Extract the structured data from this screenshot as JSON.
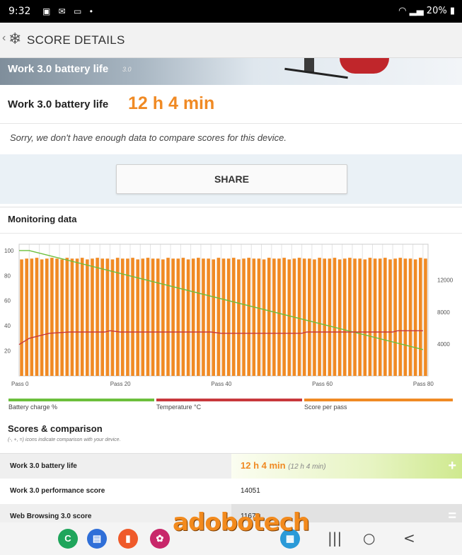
{
  "status_bar": {
    "time": "9:32",
    "battery": "20%"
  },
  "app_bar": {
    "title": "SCORE DETAILS"
  },
  "hero": {
    "title": "Work 3.0 battery life",
    "version": "3.0"
  },
  "result": {
    "label": "Work 3.0 battery life",
    "value": "12 h 4 min"
  },
  "compare_note": "Sorry, we don't have enough data to compare scores for this device.",
  "share_label": "SHARE",
  "monitoring": {
    "title": "Monitoring data",
    "legend": [
      {
        "label": "Battery charge %",
        "color": "#6cbf3c"
      },
      {
        "label": "Temperature °C",
        "color": "#c8383c"
      },
      {
        "label": "Score per pass",
        "color": "#f08a24"
      }
    ]
  },
  "chart_data": {
    "type": "bar",
    "x": {
      "tick_labels": [
        "Pass 0",
        "Pass 20",
        "Pass 40",
        "Pass 60",
        "Pass 80"
      ],
      "range": [
        0,
        81
      ]
    },
    "y_left": {
      "ticks": [
        20,
        40,
        60,
        80,
        100
      ],
      "range": [
        0,
        105
      ]
    },
    "y_right": {
      "ticks": [
        4000,
        8000,
        12000
      ],
      "range": [
        0,
        16500
      ]
    },
    "series": [
      {
        "name": "Score per pass",
        "type": "bar",
        "axis": "right",
        "color": "#f08a24",
        "values": [
          14600,
          14700,
          14700,
          14800,
          14600,
          14700,
          14800,
          14700,
          14600,
          14800,
          14700,
          14700,
          14800,
          14600,
          14700,
          14800,
          14700,
          14700,
          14600,
          14800,
          14700,
          14700,
          14800,
          14600,
          14700,
          14800,
          14700,
          14700,
          14600,
          14800,
          14700,
          14700,
          14800,
          14600,
          14700,
          14800,
          14700,
          14700,
          14600,
          14800,
          14700,
          14700,
          14800,
          14600,
          14700,
          14800,
          14700,
          14700,
          14600,
          14800,
          14700,
          14700,
          14800,
          14600,
          14700,
          14800,
          14700,
          14700,
          14600,
          14800,
          14700,
          14700,
          14800,
          14600,
          14700,
          14800,
          14700,
          14700,
          14600,
          14800,
          14700,
          14700,
          14800,
          14600,
          14700,
          14800,
          14700,
          14700,
          14600,
          14800,
          14700
        ]
      },
      {
        "name": "Battery charge %",
        "type": "line",
        "axis": "left",
        "color": "#6cbf3c",
        "points": [
          [
            0,
            100
          ],
          [
            2,
            100
          ],
          [
            80,
            21
          ]
        ]
      },
      {
        "name": "Temperature °C",
        "type": "line",
        "axis": "left",
        "color": "#c8383c",
        "points": [
          [
            0,
            25
          ],
          [
            2,
            30
          ],
          [
            4,
            32
          ],
          [
            6,
            34
          ],
          [
            10,
            35
          ],
          [
            17,
            35
          ],
          [
            18,
            36
          ],
          [
            20,
            35
          ],
          [
            38,
            35
          ],
          [
            40,
            34
          ],
          [
            56,
            34
          ],
          [
            57,
            35
          ],
          [
            74,
            35
          ],
          [
            75,
            36
          ],
          [
            80,
            36
          ]
        ]
      }
    ],
    "grid": true
  },
  "scores": {
    "title": "Scores & comparison",
    "note": "(-, +, =) icons indicate comparison with your device.",
    "rows": [
      {
        "name": "Work 3.0 battery life",
        "value": "12 h 4 min",
        "sub": "(12 h 4 min)",
        "icon": "+"
      },
      {
        "name": "Work 3.0 performance score",
        "value": "14051"
      },
      {
        "name": "Web Browsing 3.0 score",
        "value": "11675",
        "icon": "="
      }
    ]
  },
  "watermark": "adobotech",
  "nav": {
    "recents": "|||",
    "home": "○",
    "back": "<"
  },
  "dock_icons": [
    {
      "name": "phone-app-icon",
      "color": "#1fa55b",
      "glyph": "C"
    },
    {
      "name": "messages-app-icon",
      "color": "#2f6fd8",
      "glyph": "▤"
    },
    {
      "name": "notes-app-icon",
      "color": "#ef5a2a",
      "glyph": "▮"
    },
    {
      "name": "gallery-app-icon",
      "color": "#c8276a",
      "glyph": "✿"
    },
    {
      "name": "files-app-icon",
      "color": "#2a9ad8",
      "glyph": "▦"
    }
  ]
}
